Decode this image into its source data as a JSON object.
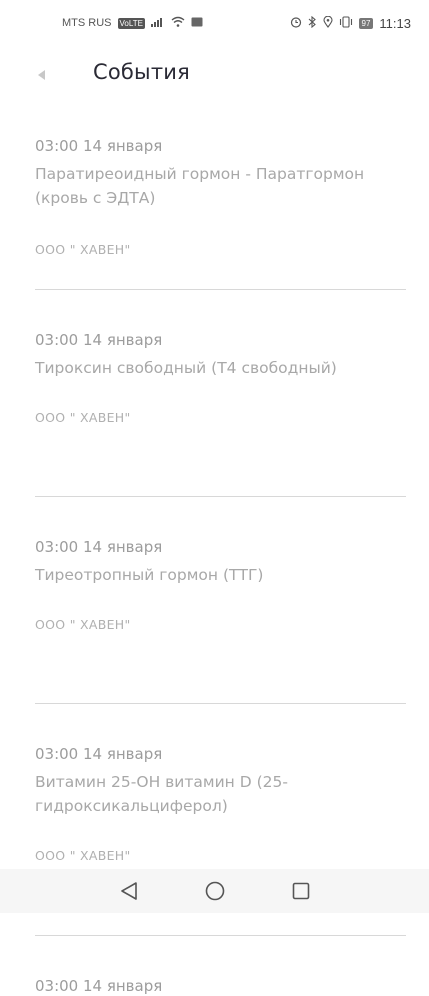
{
  "status_bar": {
    "carrier": "MTS RUS",
    "volte_badge": "VoLTE",
    "signal_icon": "signal-bars-icon",
    "wifi_icon": "wifi-icon",
    "battery": "97",
    "time": "11:13",
    "right_icons": [
      "alarm-icon",
      "bluetooth-icon",
      "location-icon",
      "vibrate-icon"
    ]
  },
  "header": {
    "back_icon": "back-arrow-icon",
    "title": "События"
  },
  "events": [
    {
      "time": "03:00  14 января",
      "title": "Паратиреоидный гормон - Паратгормон (кровь с ЭДТА)",
      "org": "ООО \" ХАВЕН\""
    },
    {
      "time": "03:00  14 января",
      "title": "Тироксин свободный (Т4 свободный)",
      "org": "ООО \" ХАВЕН\""
    },
    {
      "time": "03:00  14 января",
      "title": "Тиреотропный гормон (ТТГ)",
      "org": "ООО \" ХАВЕН\""
    },
    {
      "time": "03:00  14 января",
      "title": "Витамин 25-ОН витамин D (25-гидроксикальциферол)",
      "org": "ООО \" ХАВЕН\""
    },
    {
      "time": "03:00  14 января"
    }
  ],
  "nav_bar": {
    "back_icon": "nav-back-icon",
    "home_icon": "nav-home-icon",
    "recents_icon": "nav-recents-icon"
  },
  "colors": {
    "title": "#2a2a35",
    "text_muted": "#a8a8a8",
    "divider": "#d8d8d8",
    "nav_background": "#f6f6f6"
  }
}
